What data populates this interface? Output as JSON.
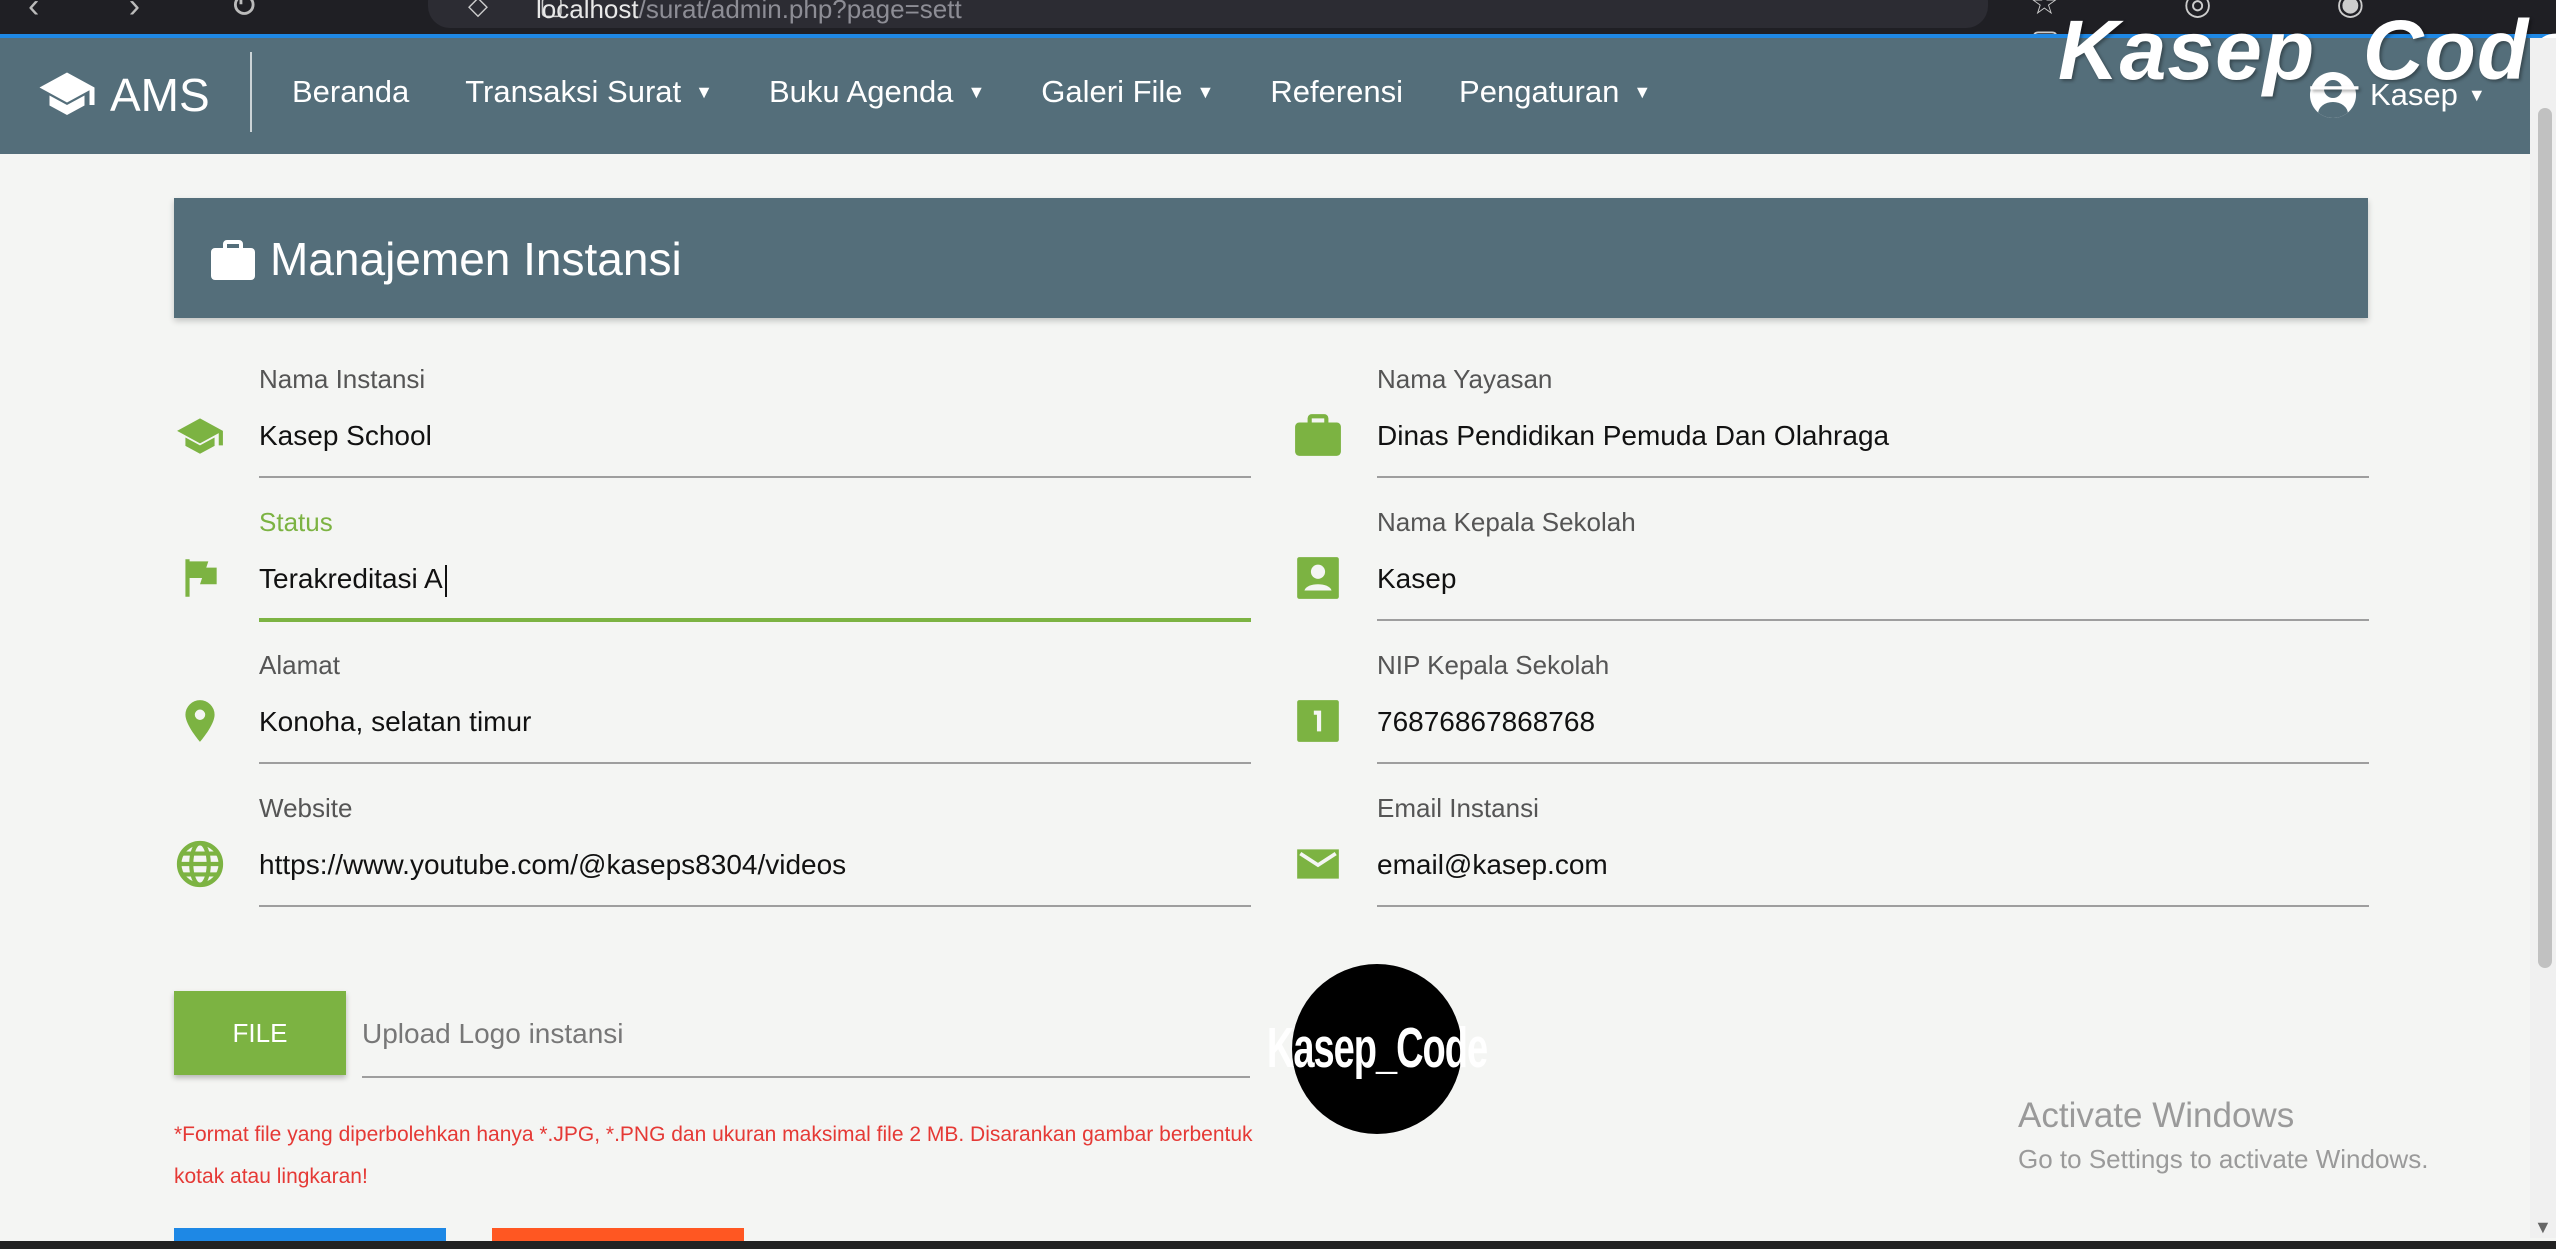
{
  "browser": {
    "url_host": "localhost",
    "url_path": "/surat/admin.php?page=sett"
  },
  "watermark": "Kasep_Code",
  "navbar": {
    "brand": "AMS",
    "menu": [
      {
        "label": "Beranda",
        "has_dropdown": false
      },
      {
        "label": "Transaksi Surat",
        "has_dropdown": true
      },
      {
        "label": "Buku Agenda",
        "has_dropdown": true
      },
      {
        "label": "Galeri File",
        "has_dropdown": true
      },
      {
        "label": "Referensi",
        "has_dropdown": false
      },
      {
        "label": "Pengaturan",
        "has_dropdown": true
      }
    ],
    "user_name": "Kasep"
  },
  "panel": {
    "title": "Manajemen Instansi",
    "icon": "briefcase-icon"
  },
  "form": {
    "nama_instansi": {
      "label": "Nama Instansi",
      "value": "Kasep School",
      "icon": "school-icon"
    },
    "status": {
      "label": "Status",
      "value": "Terakreditasi A",
      "icon": "flag-icon",
      "focused": true
    },
    "alamat": {
      "label": "Alamat",
      "value": "Konoha, selatan timur",
      "icon": "location-pin-icon"
    },
    "website": {
      "label": "Website",
      "value": "https://www.youtube.com/@kaseps8304/videos",
      "icon": "globe-icon"
    },
    "nama_yayasan": {
      "label": "Nama Yayasan",
      "value": "Dinas Pendidikan Pemuda Dan Olahraga",
      "icon": "briefcase-icon"
    },
    "nama_kepala": {
      "label": "Nama Kepala Sekolah",
      "value": "Kasep",
      "icon": "contact-card-icon"
    },
    "nip_kepala": {
      "label": "NIP Kepala Sekolah",
      "value": "76876867868768",
      "icon": "number-one-box-icon"
    },
    "email": {
      "label": "Email Instansi",
      "value": "email@kasep.com",
      "icon": "mail-icon"
    }
  },
  "upload": {
    "button_label": "FILE",
    "placeholder": "Upload Logo instansi",
    "hint": "*Format file yang diperbolehkan hanya *.JPG, *.PNG dan ukuran maksimal file 2 MB. Disarankan gambar berbentuk kotak atau lingkaran!",
    "logo_text": "Kasep_Code"
  },
  "os_notice": {
    "title": "Activate Windows",
    "subtitle": "Go to Settings to activate Windows."
  },
  "colors": {
    "primary": "#546e7a",
    "accent": "#7cb342",
    "danger": "#e53935",
    "blue_button": "#1e88e5",
    "orange_button": "#ff5722"
  }
}
